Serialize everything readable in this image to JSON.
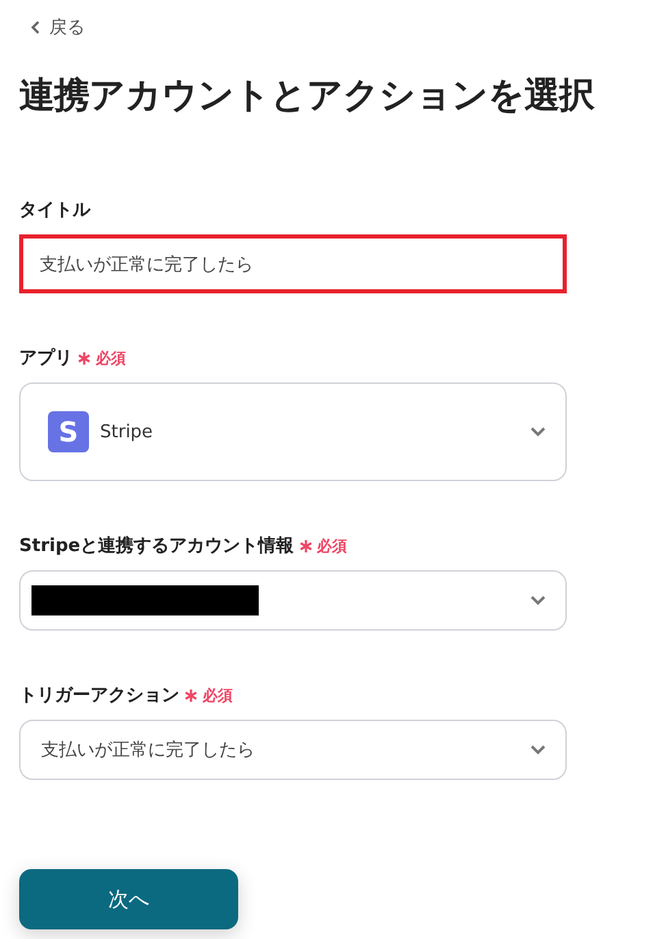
{
  "back_link": {
    "label": "戻る"
  },
  "heading": "連携アカウントとアクションを選択",
  "fields": [
    {
      "kind": "text",
      "label": "タイトル",
      "value": "支払いが正常に完了したら",
      "highlighted": true
    },
    {
      "kind": "app",
      "label": "アプリ",
      "required": true,
      "required_label": "必須",
      "app": {
        "name": "Stripe",
        "logo_letter": "S"
      }
    },
    {
      "kind": "redacted",
      "label": "Stripeと連携するアカウント情報",
      "required": true,
      "required_label": "必須"
    },
    {
      "kind": "select",
      "label": "トリガーアクション",
      "required": true,
      "required_label": "必須",
      "value": "支払いが正常に完了したら"
    }
  ],
  "next_button": {
    "label": "次へ"
  }
}
